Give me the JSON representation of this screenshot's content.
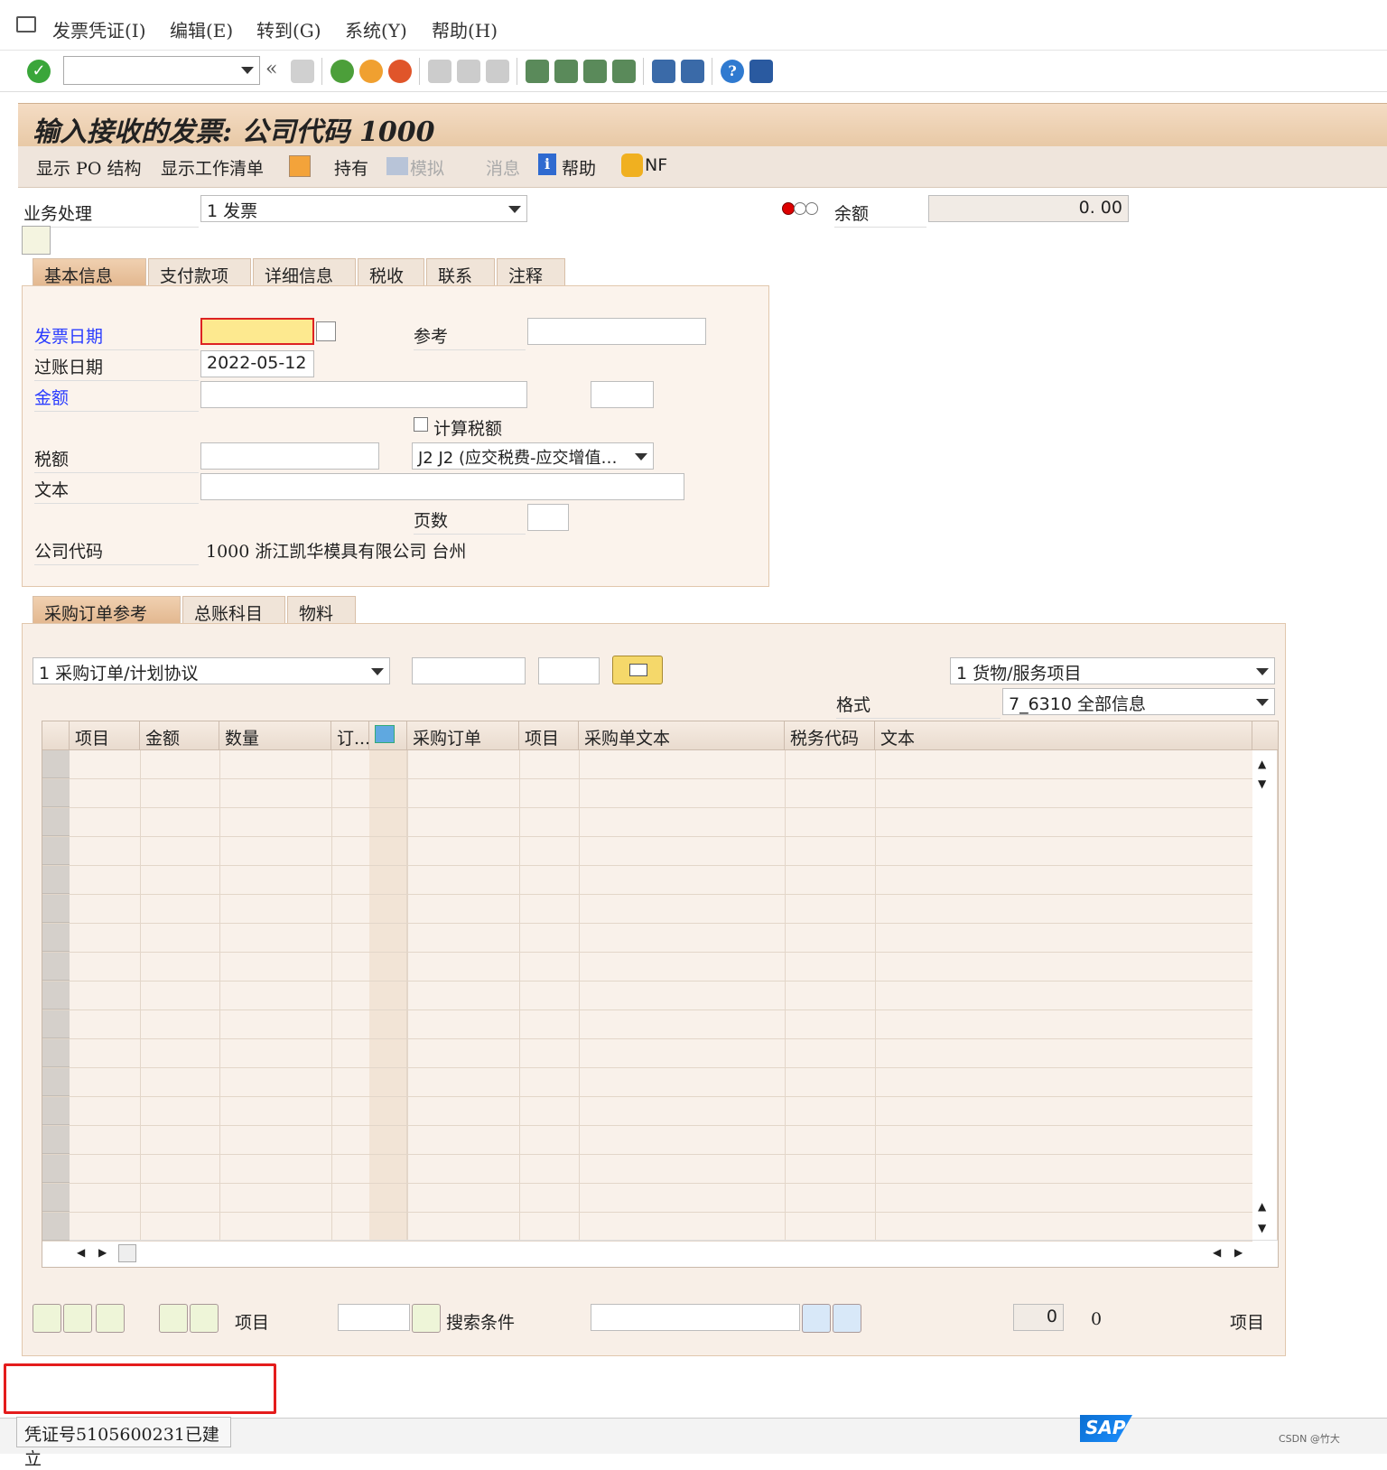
{
  "menu": {
    "items": [
      "发票凭证(I)",
      "编辑(E)",
      "转到(G)",
      "系统(Y)",
      "帮助(H)"
    ]
  },
  "toolbar": {
    "command_field_value": ""
  },
  "title": "输入接收的发票: 公司代码 1000",
  "app_toolbar": {
    "show_po_structure": "显示 PO 结构",
    "show_worklist": "显示工作清单",
    "hold": "持有",
    "simulate": "模拟",
    "messages": "消息",
    "help": "帮助",
    "nf": "NF"
  },
  "transaction": {
    "label": "业务处理",
    "value": "1 发票"
  },
  "balance": {
    "label": "余额",
    "value": "0. 00"
  },
  "header_tabs": [
    "基本信息",
    "支付款项",
    "详细信息",
    "税收",
    "联系",
    "注释"
  ],
  "basic": {
    "invoice_date_label": "发票日期",
    "invoice_date_value": "",
    "reference_label": "参考",
    "reference_value": "",
    "posting_date_label": "过账日期",
    "posting_date_value": "2022-05-12",
    "amount_label": "金额",
    "amount_value": "",
    "currency_value": "",
    "calc_tax_label": "计算税额",
    "tax_amount_label": "税额",
    "tax_amount_value": "",
    "tax_code_value": "J2 J2 (应交税费-应交增值…",
    "text_label": "文本",
    "text_value": "",
    "pages_label": "页数",
    "pages_value": "",
    "company_code_label": "公司代码",
    "company_code_value": "1000 浙江凯华模具有限公司 台州"
  },
  "item_tabs": [
    "采购订单参考",
    "总账科目",
    "物料"
  ],
  "po_ref": {
    "ref_type": "1 采购订单/计划协议",
    "po_number": "",
    "po_item": "",
    "item_type": "1 货物/服务项目",
    "layout_label": "格式",
    "layout_value": "7_6310 全部信息"
  },
  "grid": {
    "columns": [
      "项目",
      "金额",
      "数量",
      "订...",
      "",
      "采购订单",
      "项目",
      "采购单文本",
      "税务代码",
      "文本"
    ]
  },
  "bottom": {
    "item_label": "项目",
    "item_value": "",
    "search_label": "搜索条件",
    "search_value": "",
    "count_value": "0",
    "count_total": "0",
    "items_suffix": "项目"
  },
  "status": {
    "message": "凭证号5105600231已建立",
    "sap_logo": "SAP",
    "watermark": "CSDN @竹大"
  }
}
